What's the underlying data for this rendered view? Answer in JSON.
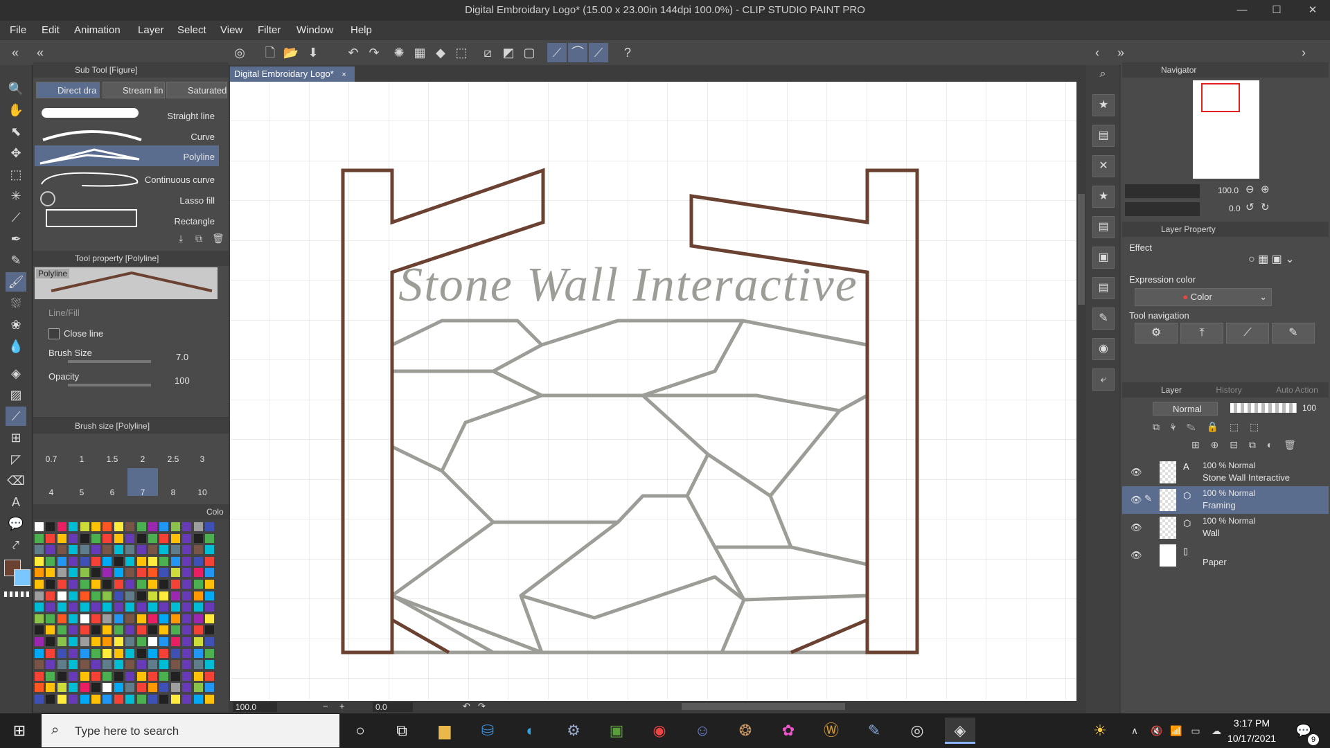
{
  "window": {
    "title": "Digital Embroidary Logo* (15.00 x 23.00in 144dpi 100.0%) - CLIP STUDIO PAINT PRO",
    "minimize": "—",
    "maximize": "☐",
    "close": "✕"
  },
  "menu": [
    "File",
    "Edit",
    "Animation",
    "Layer",
    "Select",
    "View",
    "Filter",
    "Window",
    "Help"
  ],
  "document_tab": "Digital Embroidary Logo*",
  "sub_tool": {
    "header": "Sub Tool [Figure]",
    "tabs": [
      "Direct dra",
      "Stream lin",
      "Saturated"
    ],
    "items": [
      "Straight line",
      "Curve",
      "Polyline",
      "Continuous curve",
      "Lasso fill",
      "Rectangle"
    ],
    "selected": "Polyline"
  },
  "tool_property": {
    "header": "Tool property [Polyline]",
    "preview_label": "Polyline",
    "line_fill_label": "Line/Fill",
    "close_line_label": "Close line",
    "brush_size_label": "Brush Size",
    "brush_size_value": "7.0",
    "opacity_label": "Opacity",
    "opacity_value": "100"
  },
  "brush_size": {
    "header": "Brush size [Polyline]",
    "sizes_row1": [
      "0.7",
      "1",
      "1.5",
      "2",
      "2.5",
      "3"
    ],
    "sizes_row2": [
      "4",
      "5",
      "6",
      "7",
      "8",
      "10"
    ],
    "selected": "2"
  },
  "color_set_tab": "Colo",
  "canvas": {
    "logo_text": "Stone Wall Interactive",
    "frame_color": "#6b4232",
    "stone_color": "#9d9d98"
  },
  "navigator": {
    "header": "Navigator",
    "zoom": "100.0",
    "rotation": "0.0"
  },
  "layer_property": {
    "header": "Layer Property",
    "effect_label": "Effect",
    "expression_color_label": "Expression color",
    "expression_color_value": "Color",
    "tool_navigation_label": "Tool navigation"
  },
  "layer_panel": {
    "tabs": [
      "Layer",
      "History",
      "Auto Action"
    ],
    "blend_mode": "Normal",
    "opacity": "100",
    "layers": [
      {
        "mode": "100 % Normal",
        "name": "Stone Wall Interactive",
        "selected": false
      },
      {
        "mode": "100 % Normal",
        "name": "Framing",
        "selected": true
      },
      {
        "mode": "100 % Normal",
        "name": "Wall",
        "selected": false
      },
      {
        "mode": "",
        "name": "Paper",
        "selected": false
      }
    ]
  },
  "status": {
    "zoom": "100.0",
    "angle": "0.0"
  },
  "taskbar": {
    "search_placeholder": "Type here to search",
    "time": "3:17 PM",
    "date": "10/17/2021",
    "notifications": "9"
  },
  "colors": {
    "accent": "#5b6d8f",
    "main_color": "#6b4232",
    "sub_color": "#7ac7ff"
  }
}
